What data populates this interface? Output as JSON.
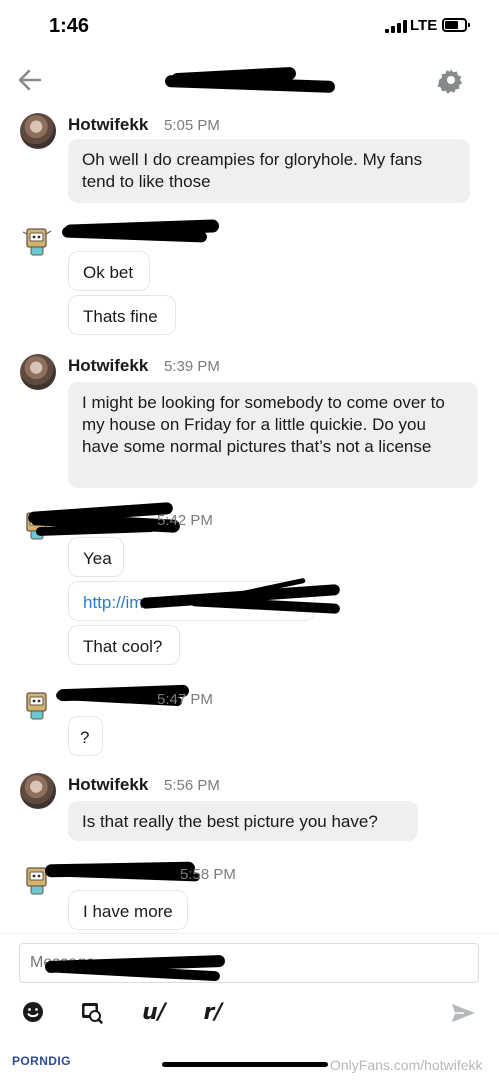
{
  "status_bar": {
    "time": "1:46",
    "network": "LTE"
  },
  "messages": [
    {
      "sender": "Hotwifekk",
      "time": "5:05 PM",
      "text": "Oh well I do creampies for gloryhole. My fans tend to like those"
    },
    {
      "text_1": "Ok bet",
      "text_2": "Thats fine"
    },
    {
      "sender": "Hotwifekk",
      "time": "5:39 PM",
      "text": "I might be looking for somebody to come over to my house on Friday for a little quickie. Do you have some normal pictures that’s not a license"
    },
    {
      "time": "5:42 PM",
      "text_1": "Yea",
      "link": "http://im",
      "text_3": "That cool?"
    },
    {
      "time": "5:47 PM",
      "text": "?"
    },
    {
      "sender": "Hotwifekk",
      "time": "5:56 PM",
      "text": "Is that really the best picture you have?"
    },
    {
      "time": "5:58 PM",
      "text": "I have more"
    }
  ],
  "composer": {
    "placeholder": "Message",
    "subreddit_label": "r/",
    "user_label": "u/"
  },
  "footer": {
    "brand": "PORNDIG",
    "watermark": "OnlyFans.com/hotwifekk"
  }
}
